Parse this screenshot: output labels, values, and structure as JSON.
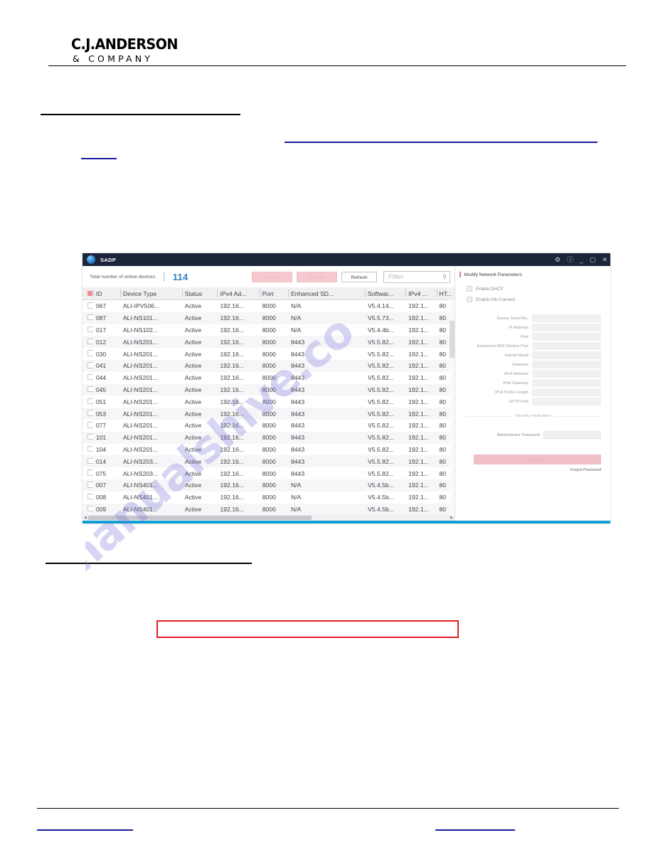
{
  "document": {
    "brand": {
      "line1": "C.J.ANDERSON",
      "line2": "& COMPANY"
    },
    "watermark": "manualshive.co"
  },
  "sadp": {
    "titlebar": {
      "title": "SADP",
      "logo_icon": "sadp-logo-icon",
      "gear_icon": "⚙",
      "info_icon": "ⓘ",
      "minimize_icon": "_",
      "maximize_icon": "▢",
      "close_icon": "✕"
    },
    "toolbar": {
      "total_label": "Total number of online devices:",
      "total_count": "114",
      "upload_label": "Upload",
      "export_label": "Export",
      "refresh_label": "Refresh",
      "filter_placeholder": "Filter",
      "search_icon": "search-icon"
    },
    "table": {
      "columns": [
        "ID",
        "Device Type",
        "Status",
        "IPv4 Ad...",
        "Port",
        "Enhanced SD...",
        "Softwar...",
        "IPv4 ...",
        "HT..."
      ],
      "rows": [
        {
          "id": "067",
          "type": "ALI-IPV506...",
          "status": "Active",
          "ipv4": "192.16...",
          "port": "8000",
          "sdk": "N/A",
          "software": "V5.4.14...",
          "gateway": "192.1...",
          "http": "80"
        },
        {
          "id": "087",
          "type": "ALI-NS101...",
          "status": "Active",
          "ipv4": "192.16...",
          "port": "8000",
          "sdk": "N/A",
          "software": "V5.5.73...",
          "gateway": "192.1...",
          "http": "80"
        },
        {
          "id": "017",
          "type": "ALI-NS102...",
          "status": "Active",
          "ipv4": "192.16...",
          "port": "8000",
          "sdk": "N/A",
          "software": "V5.4.4b...",
          "gateway": "192.1...",
          "http": "80"
        },
        {
          "id": "012",
          "type": "ALI-NS201...",
          "status": "Active",
          "ipv4": "192.16...",
          "port": "8000",
          "sdk": "8443",
          "software": "V5.5.82...",
          "gateway": "192.1...",
          "http": "80"
        },
        {
          "id": "030",
          "type": "ALI-NS201...",
          "status": "Active",
          "ipv4": "192.16...",
          "port": "8000",
          "sdk": "8443",
          "software": "V5.5.82...",
          "gateway": "192.1...",
          "http": "80"
        },
        {
          "id": "041",
          "type": "ALI-NS201...",
          "status": "Active",
          "ipv4": "192.16...",
          "port": "8000",
          "sdk": "8443",
          "software": "V5.5.82...",
          "gateway": "192.1...",
          "http": "80"
        },
        {
          "id": "044",
          "type": "ALI-NS201...",
          "status": "Active",
          "ipv4": "192.16...",
          "port": "8000",
          "sdk": "8443",
          "software": "V5.5.82...",
          "gateway": "192.1...",
          "http": "80"
        },
        {
          "id": "045",
          "type": "ALI-NS201...",
          "status": "Active",
          "ipv4": "192.16...",
          "port": "8000",
          "sdk": "8443",
          "software": "V5.5.82...",
          "gateway": "192.1...",
          "http": "80"
        },
        {
          "id": "051",
          "type": "ALI-NS201...",
          "status": "Active",
          "ipv4": "192.16...",
          "port": "8000",
          "sdk": "8443",
          "software": "V5.5.82...",
          "gateway": "192.1...",
          "http": "80"
        },
        {
          "id": "053",
          "type": "ALI-NS201...",
          "status": "Active",
          "ipv4": "192.16...",
          "port": "8000",
          "sdk": "8443",
          "software": "V5.5.82...",
          "gateway": "192.1...",
          "http": "80"
        },
        {
          "id": "077",
          "type": "ALI-NS201...",
          "status": "Active",
          "ipv4": "192.16...",
          "port": "8000",
          "sdk": "8443",
          "software": "V5.5.82...",
          "gateway": "192.1...",
          "http": "80"
        },
        {
          "id": "101",
          "type": "ALI-NS201...",
          "status": "Active",
          "ipv4": "192.16...",
          "port": "8000",
          "sdk": "8443",
          "software": "V5.5.82...",
          "gateway": "192.1...",
          "http": "80"
        },
        {
          "id": "104",
          "type": "ALI-NS201...",
          "status": "Active",
          "ipv4": "192.16...",
          "port": "8000",
          "sdk": "8443",
          "software": "V5.5.82...",
          "gateway": "192.1...",
          "http": "80"
        },
        {
          "id": "014",
          "type": "ALI-NS203...",
          "status": "Active",
          "ipv4": "192.16...",
          "port": "8000",
          "sdk": "8443",
          "software": "V5.5.82...",
          "gateway": "192.1...",
          "http": "80"
        },
        {
          "id": "075",
          "type": "ALI-NS203...",
          "status": "Active",
          "ipv4": "192.16...",
          "port": "8000",
          "sdk": "8443",
          "software": "V5.5.82...",
          "gateway": "192.1...",
          "http": "80"
        },
        {
          "id": "007",
          "type": "ALI-NS401...",
          "status": "Active",
          "ipv4": "192.16...",
          "port": "8000",
          "sdk": "N/A",
          "software": "V5.4.5b...",
          "gateway": "192.1...",
          "http": "80"
        },
        {
          "id": "008",
          "type": "ALI-NS401...",
          "status": "Active",
          "ipv4": "192.16...",
          "port": "8000",
          "sdk": "N/A",
          "software": "V5.4.5b...",
          "gateway": "192.1...",
          "http": "80"
        },
        {
          "id": "009",
          "type": "ALI-NS401...",
          "status": "Active",
          "ipv4": "192.16...",
          "port": "8000",
          "sdk": "N/A",
          "software": "V5.4.5b...",
          "gateway": "192.1...",
          "http": "80"
        }
      ]
    },
    "panel": {
      "title": "Modify Network Parameters",
      "enable_dhcp": "Enable DHCP",
      "enable_hik_connect": "Enable Hik-Connect",
      "fields": [
        "Device Serial No.:",
        "IP Address:",
        "Port:",
        "Enhanced SDK Service Port:",
        "Subnet Mask:",
        "Gateway:",
        "IPv6 Address:",
        "IPv6 Gateway:",
        "IPv6 Prefix Length:",
        "HTTP Port:"
      ],
      "security_section": "Security Verification",
      "admin_password_label": "Administrator Password:",
      "modify_button": "Modify",
      "forgot_password": "Forgot Password"
    }
  },
  "colors": {
    "accent_blue": "#2c7fc9",
    "window_bottom": "#0e9fd4",
    "pink_disabled": "#f4c9cf",
    "redbox": "#dd1f26",
    "link_blue": "#1a1a9c",
    "titlebar": "#1b2438"
  }
}
